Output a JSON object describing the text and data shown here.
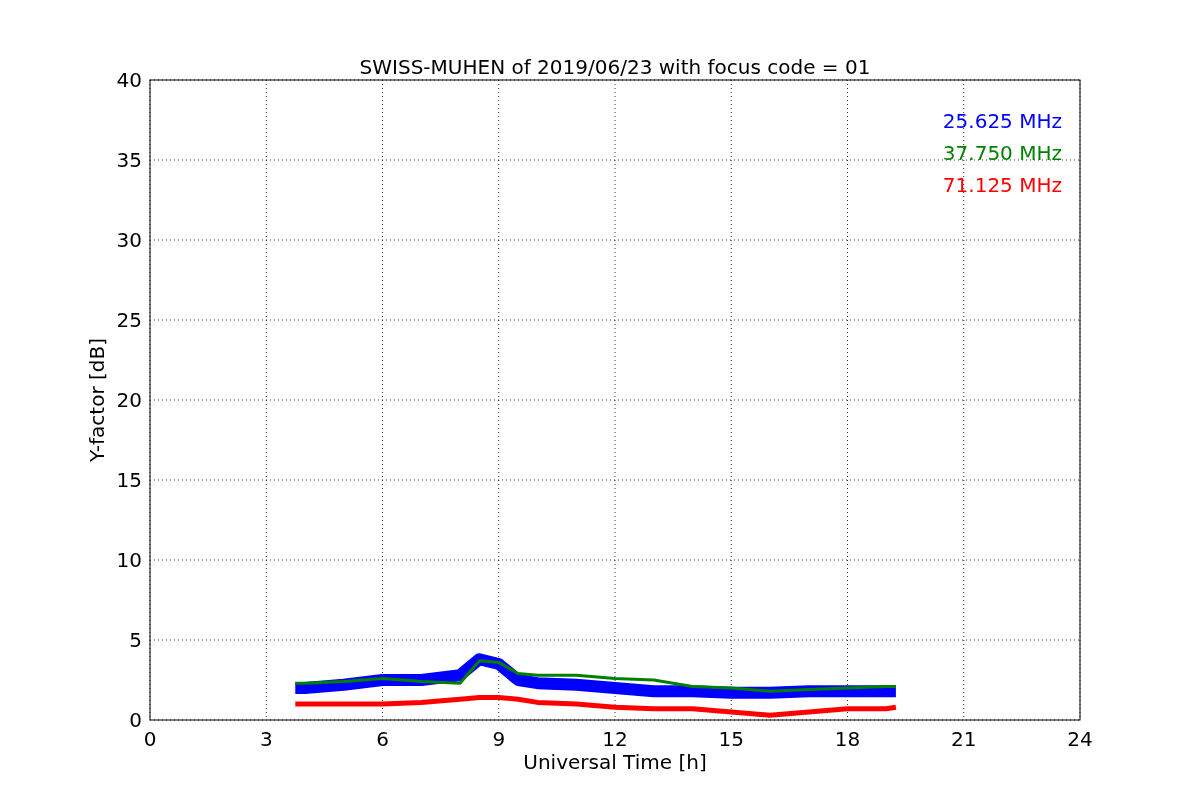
{
  "chart_data": {
    "type": "line",
    "title": "SWISS-MUHEN of 2019/06/23 with focus code = 01",
    "xlabel": "Universal Time [h]",
    "ylabel": "Y-factor [dB]",
    "x": [
      3.75,
      4,
      5,
      6,
      7,
      8,
      8.5,
      9,
      9.5,
      10,
      11,
      12,
      13,
      14,
      15,
      16,
      17,
      18,
      19,
      19.25
    ],
    "series": [
      {
        "name": "25.625 MHz",
        "color": "#0000ff",
        "values": [
          2,
          2,
          2.2,
          2.5,
          2.5,
          2.8,
          3.8,
          3.5,
          2.5,
          2.3,
          2.2,
          2,
          1.8,
          1.8,
          1.7,
          1.7,
          1.8,
          1.8,
          1.8,
          1.8
        ]
      },
      {
        "name": "37.750 MHz",
        "color": "#008000",
        "values": [
          2.3,
          2.3,
          2.4,
          2.6,
          2.4,
          2.3,
          3.7,
          3.6,
          2.9,
          2.8,
          2.8,
          2.6,
          2.5,
          2.1,
          2,
          1.8,
          1.9,
          2,
          2.1,
          2.1
        ]
      },
      {
        "name": "71.125 MHz",
        "color": "#ff0000",
        "values": [
          1,
          1,
          1,
          1,
          1.1,
          1.3,
          1.4,
          1.4,
          1.3,
          1.1,
          1,
          0.8,
          0.7,
          0.7,
          0.5,
          0.3,
          0.5,
          0.7,
          0.7,
          0.8
        ]
      }
    ],
    "xlim": [
      0,
      24
    ],
    "ylim": [
      0,
      40
    ],
    "xticks": [
      0,
      3,
      6,
      9,
      12,
      15,
      18,
      21,
      24
    ],
    "yticks": [
      0,
      5,
      10,
      15,
      20,
      25,
      30,
      35,
      40
    ],
    "grid": true
  }
}
